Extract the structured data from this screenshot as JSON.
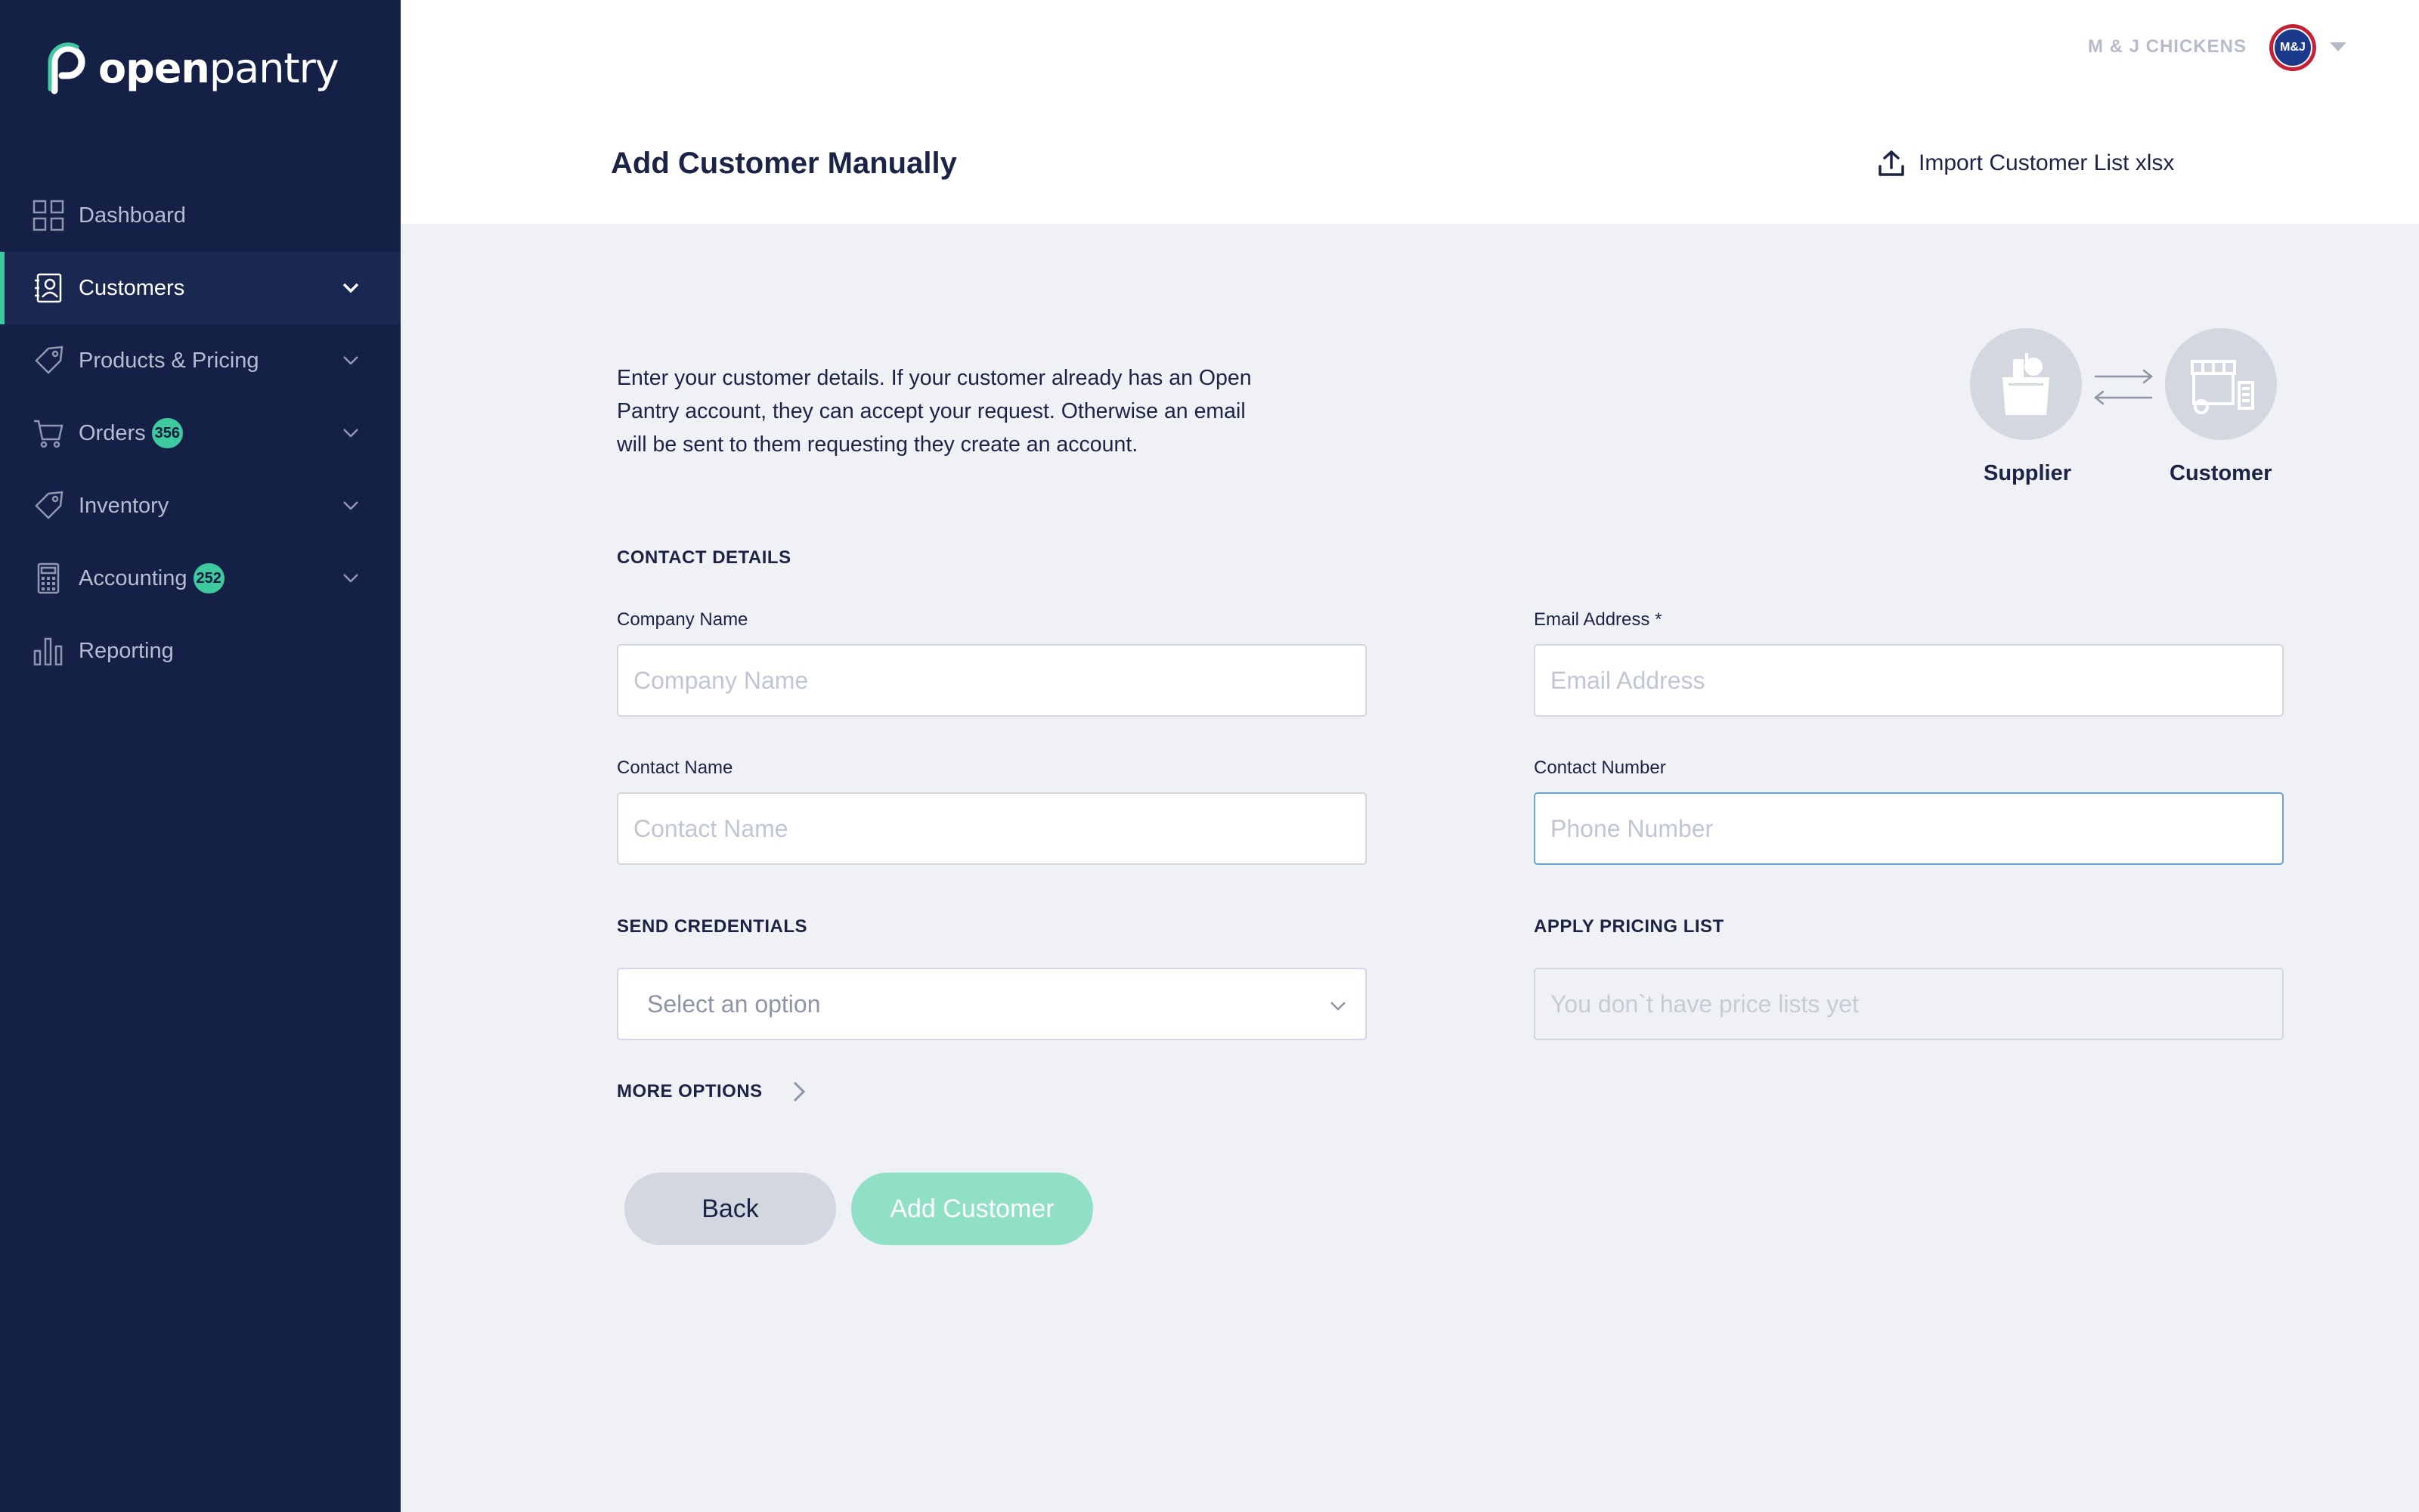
{
  "app": {
    "brand_bold": "open",
    "brand_rest": "pantry"
  },
  "sidebar": {
    "items": [
      {
        "label": "Dashboard",
        "icon": "dashboard-icon",
        "active": false,
        "has_chevron": false,
        "badge": null
      },
      {
        "label": "Customers",
        "icon": "customers-icon",
        "active": true,
        "has_chevron": true,
        "badge": null
      },
      {
        "label": "Products & Pricing",
        "icon": "tag-icon",
        "active": false,
        "has_chevron": true,
        "badge": null
      },
      {
        "label": "Orders",
        "icon": "cart-icon",
        "active": false,
        "has_chevron": true,
        "badge": "356"
      },
      {
        "label": "Inventory",
        "icon": "tag-icon",
        "active": false,
        "has_chevron": true,
        "badge": null
      },
      {
        "label": "Accounting",
        "icon": "calculator-icon",
        "active": false,
        "has_chevron": true,
        "badge": "252"
      },
      {
        "label": "Reporting",
        "icon": "bar-chart-icon",
        "active": false,
        "has_chevron": false,
        "badge": null
      }
    ]
  },
  "topbar": {
    "company_name": "M & J CHICKENS",
    "avatar_text": "M&J"
  },
  "header": {
    "title": "Add Customer Manually",
    "import_label": "Import Customer List xlsx"
  },
  "intro": {
    "text": "Enter your customer details. If your customer already has an Open Pantry account, they can accept your request. Otherwise an email will be sent to them requesting they create an account."
  },
  "relationship": {
    "supplier_label": "Supplier",
    "customer_label": "Customer"
  },
  "form": {
    "contact_section": "CONTACT DETAILS",
    "company_name": {
      "label": "Company Name",
      "placeholder": "Company Name",
      "value": ""
    },
    "email": {
      "label": "Email Address *",
      "placeholder": "Email Address",
      "value": ""
    },
    "contact_name": {
      "label": "Contact Name",
      "placeholder": "Contact Name",
      "value": ""
    },
    "contact_number": {
      "label": "Contact Number",
      "placeholder": "Phone Number",
      "value": ""
    },
    "send_credentials": {
      "label": "SEND CREDENTIALS",
      "selected": "Select an option"
    },
    "pricing_list": {
      "label": "APPLY PRICING LIST",
      "placeholder": "You don`t have price lists yet"
    },
    "more_options": "MORE OPTIONS"
  },
  "actions": {
    "back": "Back",
    "add": "Add Customer"
  },
  "colors": {
    "sidebar_bg": "#152046",
    "accent": "#3ec99e",
    "text_dark": "#1b2447",
    "page_bg": "#eff1f4"
  }
}
